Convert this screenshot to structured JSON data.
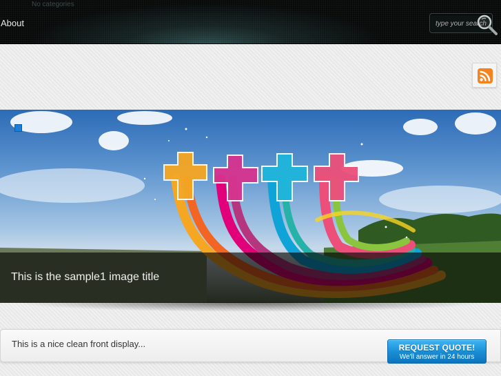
{
  "header": {
    "categories_text": "No categories",
    "nav": {
      "about_label": "About"
    },
    "search": {
      "placeholder": "type your search"
    }
  },
  "rss": {
    "icon": "rss-icon",
    "color": "#f58220"
  },
  "slider": {
    "caption": "This is the sample1 image title",
    "nav_dot_color": "#1a7fd8"
  },
  "promo": {
    "text": "This is a nice clean front display...",
    "button_title": "REQUEST QUOTE!",
    "button_subtitle": "We'll answer in 24 hours",
    "button_color": "#1a8fd6"
  }
}
